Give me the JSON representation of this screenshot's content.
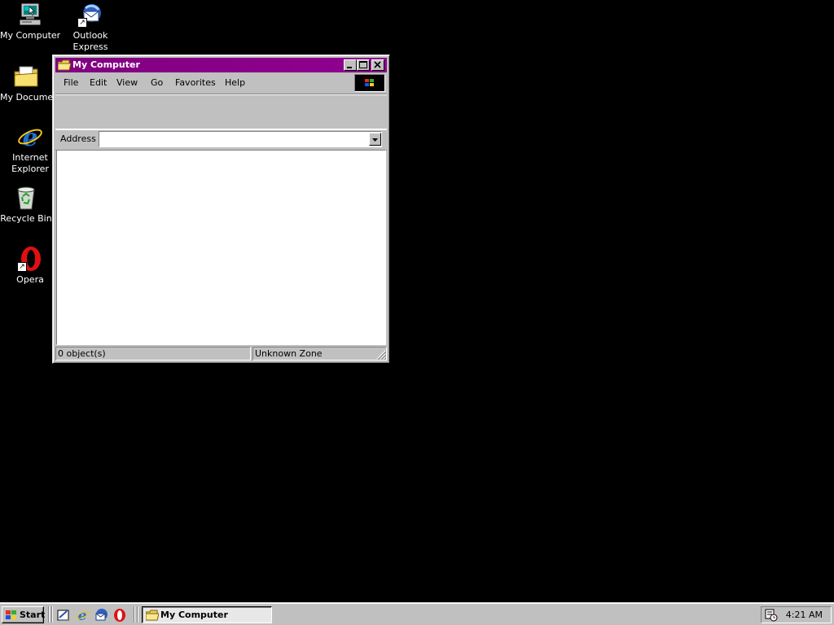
{
  "desktop": {
    "icons": [
      {
        "label": "My Computer",
        "icon": "my-computer-icon"
      },
      {
        "label": "Outlook Express",
        "icon": "outlook-express-icon"
      },
      {
        "label": "My Documents",
        "icon": "my-documents-icon"
      },
      {
        "label": "Internet Explorer",
        "icon": "internet-explorer-icon"
      },
      {
        "label": "Recycle Bin",
        "icon": "recycle-bin-icon"
      },
      {
        "label": "Opera",
        "icon": "opera-icon"
      }
    ]
  },
  "window": {
    "title": "My Computer",
    "title_color": "#800080",
    "menu": [
      "File",
      "Edit",
      "View",
      "Go",
      "Favorites",
      "Help"
    ],
    "address_label": "Address",
    "address_value": "",
    "status_left": "0 object(s)",
    "status_right": "Unknown Zone"
  },
  "taskbar": {
    "start_label": "Start",
    "quick_launch": [
      "show-desktop-icon",
      "internet-explorer-icon",
      "outlook-express-icon",
      "opera-icon"
    ],
    "task_label": "My Computer",
    "clock": "4:21 AM"
  }
}
